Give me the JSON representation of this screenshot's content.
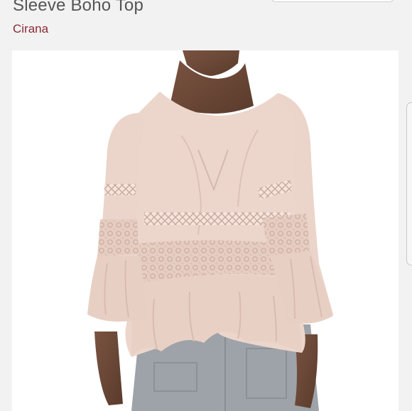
{
  "listing": {
    "title": "Sleeve Boho Top",
    "brand": "Cirana"
  },
  "colors": {
    "brand_text": "#8a2b36",
    "title_text": "#555555",
    "blouse": "#ecd6cc",
    "pants": "#9da3a8",
    "skin": "#6b4a38"
  },
  "photo": {
    "subject": "model wearing blush bell-sleeve boho top with lace insets"
  }
}
